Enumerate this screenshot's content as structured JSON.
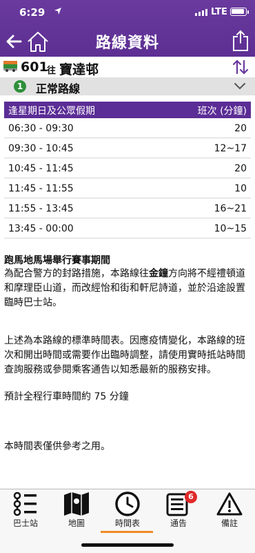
{
  "status_bar": {
    "time": "6:29",
    "network": "LTE"
  },
  "header": {
    "title": "路線資料"
  },
  "route": {
    "number": "601",
    "direction_word": "往",
    "destination": "寶達邨"
  },
  "variant": {
    "index": "1",
    "label": "正常路線"
  },
  "timetable": {
    "header_period": "逢星期日及公眾假期",
    "header_frequency": "班次 (分鐘)",
    "rows": [
      {
        "period": "06:30 - 09:30",
        "frequency": "20"
      },
      {
        "period": "09:30 - 10:45",
        "frequency": "12~17"
      },
      {
        "period": "10:45 - 11:45",
        "frequency": "20"
      },
      {
        "period": "11:45 - 11:55",
        "frequency": "10"
      },
      {
        "period": "11:55 - 13:45",
        "frequency": "16~21"
      },
      {
        "period": "13:45 - 00:00",
        "frequency": "10~15"
      }
    ]
  },
  "notices": {
    "title": "跑馬地馬場舉行賽事期間",
    "p1_before": "為配合警方的封路措施，本路線往",
    "p1_bold": "金鐘",
    "p1_after": "方向將不經禮頓道和摩理臣山道，而改經怡和街和軒尼詩道，並於沿途設置臨時巴士站。",
    "p2": "上述為本路線的標準時間表。因應疫情變化，本路線的班次和開出時間或需要作出臨時調整，請使用實時抵站時間查詢服務或參閱乘客通告以知悉最新的服務安排。",
    "p3": "預計全程行車時間約 75 分鐘",
    "p4": "本時間表僅供參考之用。"
  },
  "tabs": [
    {
      "label": "巴士站",
      "icon": "bus-stops-icon"
    },
    {
      "label": "地圖",
      "icon": "map-icon"
    },
    {
      "label": "時間表",
      "icon": "clock-icon",
      "active": true
    },
    {
      "label": "通告",
      "icon": "notice-icon",
      "badge": "6"
    },
    {
      "label": "備註",
      "icon": "warning-icon"
    }
  ],
  "colors": {
    "header": "#5d2f93",
    "tab_active_underline": "#f08a24",
    "badge": "#e02a2a",
    "variant_badge": "#2f8f3a"
  }
}
